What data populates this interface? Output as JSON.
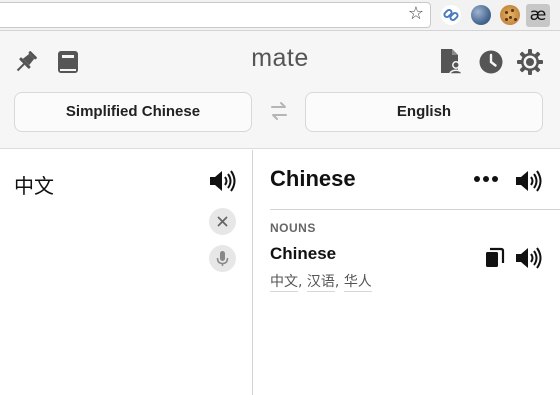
{
  "browser": {
    "bookmark_icon": "star-icon",
    "extensions": [
      "link-extension-icon",
      "globe-extension-icon",
      "cookie-extension-icon",
      "mate-extension-icon"
    ],
    "mate_extension_label": "æ"
  },
  "header": {
    "title": "mate",
    "source_language": "Simplified Chinese",
    "target_language": "English",
    "icons": [
      "pin-icon",
      "phrasebook-icon",
      "favorite-user-icon",
      "history-icon",
      "settings-icon",
      "swap-languages-icon"
    ]
  },
  "source": {
    "text": "中文"
  },
  "result": {
    "headword": "Chinese",
    "sections": [
      {
        "part_of_speech": "NOUNS",
        "entries": [
          {
            "word": "Chinese",
            "synonyms": [
              "中文",
              "汉语",
              "华人"
            ]
          }
        ]
      }
    ]
  },
  "colors": {
    "header_background": "#f6f6f6",
    "divider": "#d4d4d4",
    "text_primary": "#111111",
    "text_secondary": "#555555"
  }
}
